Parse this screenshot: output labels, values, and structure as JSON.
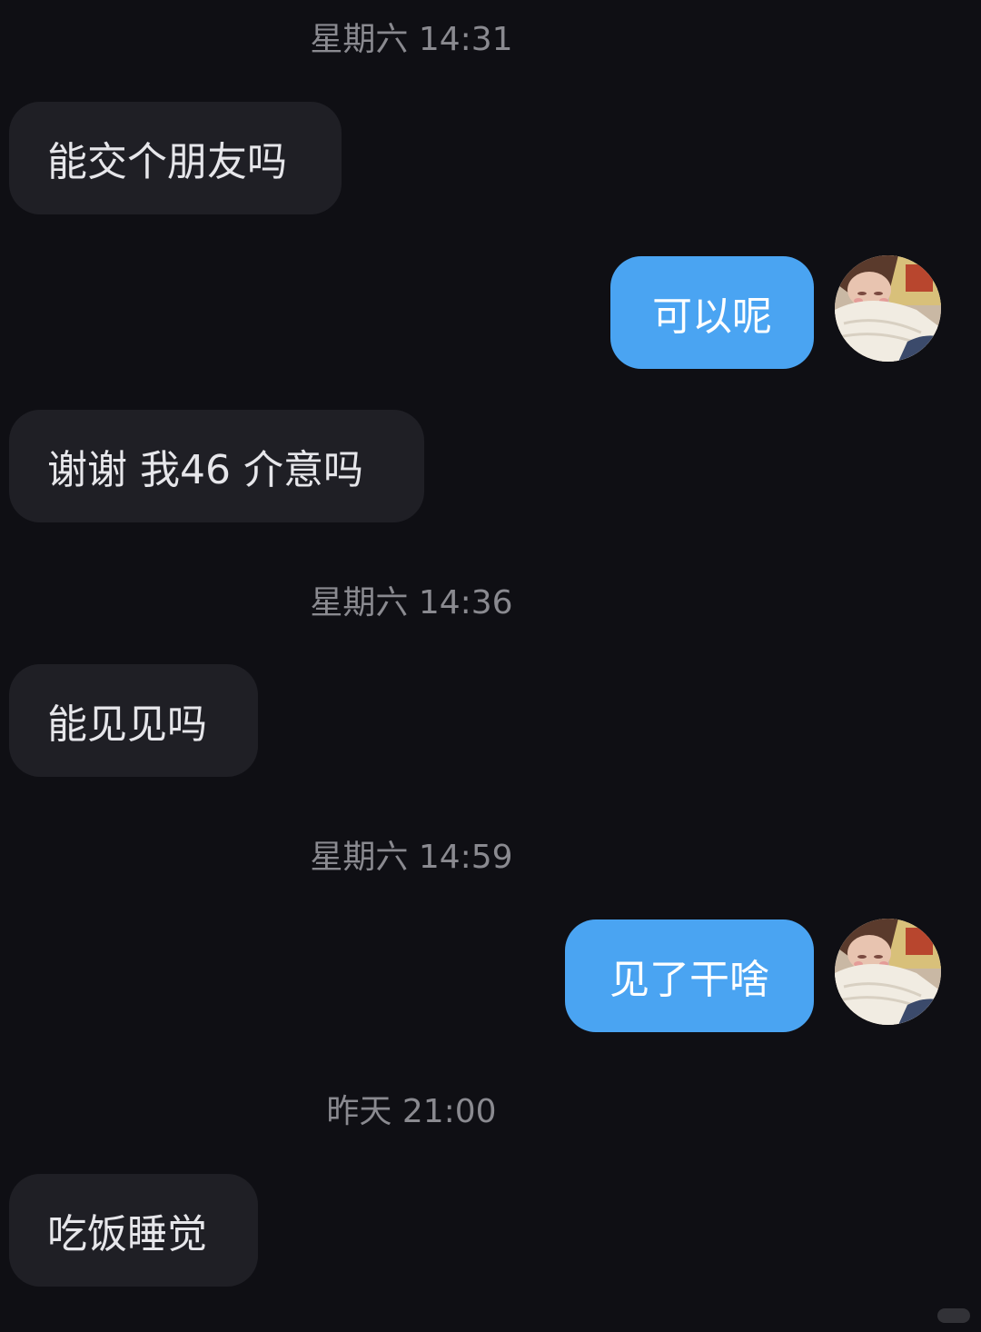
{
  "chat": {
    "timestamps": [
      "星期六 14:31",
      "星期六 14:36",
      "星期六 14:59",
      "昨天 21:00"
    ],
    "messages": [
      {
        "side": "incoming",
        "text": "能交个朋友吗"
      },
      {
        "side": "outgoing",
        "text": "可以呢"
      },
      {
        "side": "incoming",
        "text": "谢谢 我46 介意吗"
      },
      {
        "side": "incoming",
        "text": "能见见吗"
      },
      {
        "side": "outgoing",
        "text": "见了干啥"
      },
      {
        "side": "incoming",
        "text": "吃饭睡觉"
      }
    ]
  },
  "colors": {
    "background": "#0f0f14",
    "incoming_bubble": "#1f1f25",
    "outgoing_bubble": "#4aa4f2",
    "timestamp_text": "#8a8a90"
  },
  "icons": {
    "avatar": "user-avatar-illustration",
    "watermark": "watermark-logo"
  }
}
